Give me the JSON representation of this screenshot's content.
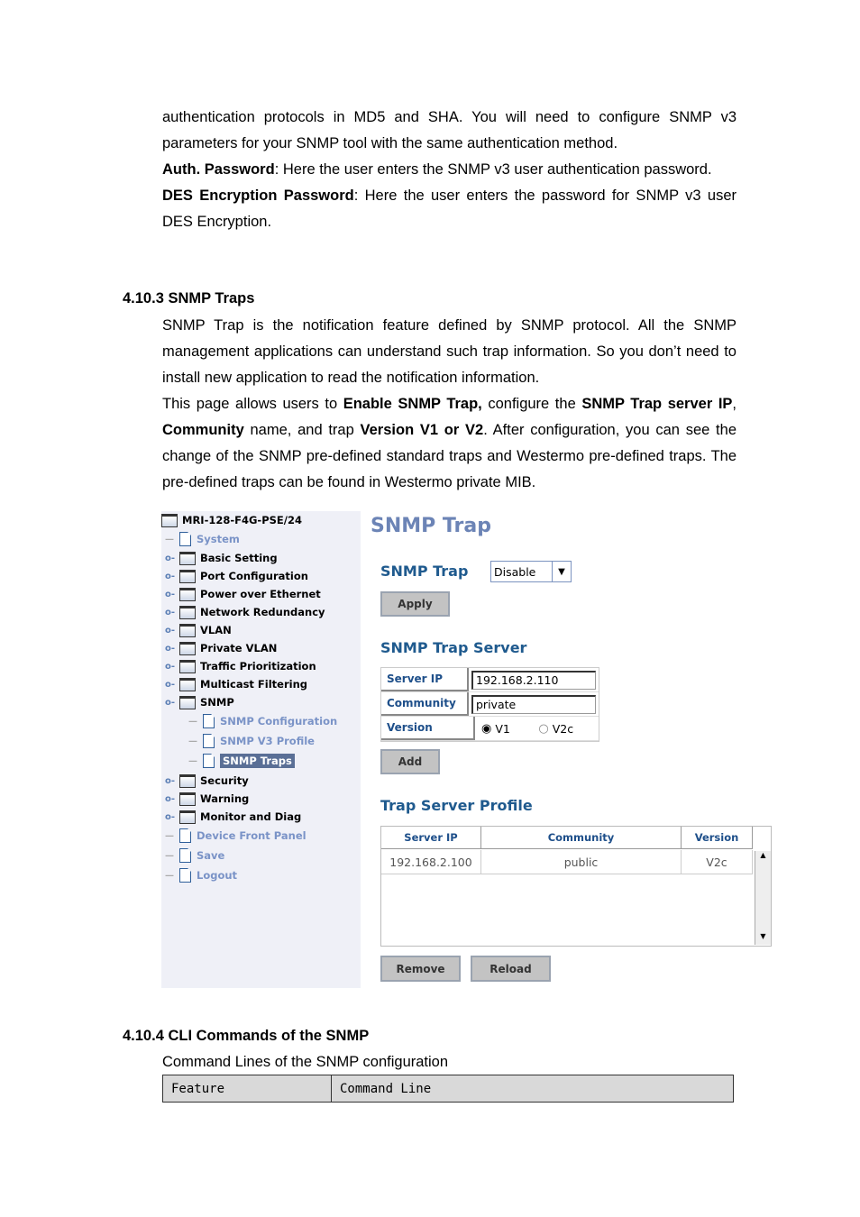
{
  "doc": {
    "p1": [
      {
        "t": "authentication protocols in MD5 and SHA. You will need to configure SNMP v3 parameters for your SNMP tool with the same authentication method.",
        "b": false
      }
    ],
    "auth_label": "Auth. Password",
    "auth_text": ": Here the user enters the SNMP v3 user authentication password.",
    "des_label": "DES Encryption Password",
    "des_text": ": Here the user enters the password for SNMP v3 user DES Encryption.",
    "h1": "4.10.3  SNMP Traps",
    "p2": "SNMP Trap is the notification feature defined by SNMP protocol. All the SNMP management applications can understand such trap information. So you don’t need to install new application to read the notification information.",
    "p3": [
      "This page allows users to ",
      "Enable SNMP Trap,",
      " configure the ",
      "SNMP Trap server IP",
      ", ",
      "Community",
      " name, and trap ",
      "Version V1 or V2",
      ". After configuration, you can see the change of the SNMP pre-defined standard traps and Westermo pre-defined traps. The pre-defined traps can be found in Westermo private MIB."
    ],
    "h2": "4.10.4  CLI Commands of the SNMP",
    "p4": "Command Lines of the SNMP configuration",
    "cli_headers": [
      "Feature",
      "Command Line"
    ]
  },
  "p1_text": "authentication protocols in MD5 and SHA. You will need to configure SNMP v3 parameters for your SNMP tool with the same authentication method.",
  "tree": {
    "root": "MRI-128-F4G-PSE/24",
    "items": [
      "System",
      "Basic Setting",
      "Port Configuration",
      "Power over Ethernet",
      "Network Redundancy",
      "VLAN",
      "Private VLAN",
      "Traffic Prioritization",
      "Multicast Filtering",
      "SNMP",
      "SNMP Configuration",
      "SNMP V3 Profile",
      "SNMP Traps",
      "Security",
      "Warning",
      "Monitor and Diag",
      "Device Front Panel",
      "Save",
      "Logout"
    ]
  },
  "panel": {
    "title": "SNMP Trap",
    "trap_label": "SNMP Trap",
    "trap_value": "Disable",
    "apply": "Apply",
    "server_title": "SNMP Trap Server",
    "server_ip_label": "Server IP",
    "server_ip": "192.168.2.110",
    "community_label": "Community",
    "community": "private",
    "version_label": "Version",
    "v1": "V1",
    "v2c": "V2c",
    "version_selected": "V1",
    "add": "Add",
    "profile_title": "Trap Server Profile",
    "table_headers": [
      "Server IP",
      "Community",
      "Version"
    ],
    "rows": [
      [
        "192.168.2.100",
        "public",
        "V2c"
      ]
    ],
    "remove": "Remove",
    "reload": "Reload"
  },
  "colors": {
    "title": "#6c84b6",
    "section": "#1f5a8e",
    "sidebar_bg": "#eff0f7",
    "selected": "#5a6f96"
  }
}
